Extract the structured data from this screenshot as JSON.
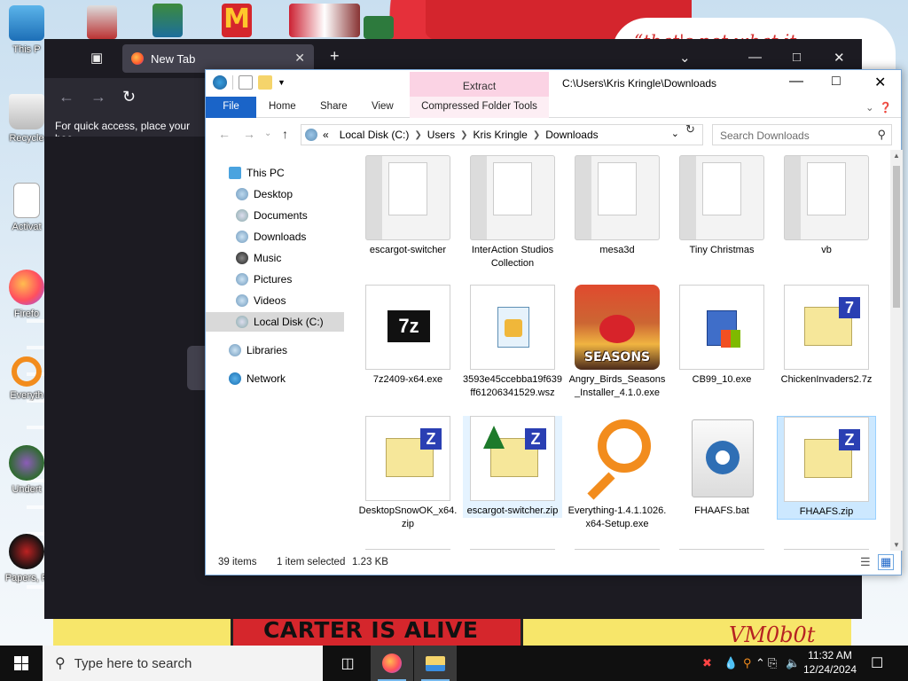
{
  "desktop": {
    "wallpaper_text": "CARTER IS ALIVE",
    "wallpaper_signature": "VM0b0t",
    "card_text": "“that's not what it",
    "icons": [
      {
        "label": "This P",
        "icon": "computer-icon"
      },
      {
        "label": "Recycle",
        "icon": "recycle-bin-icon"
      },
      {
        "label": "Activat",
        "icon": "document-icon"
      },
      {
        "label": "Firefo",
        "icon": "firefox-icon"
      },
      {
        "label": "Everyth",
        "icon": "everything-search-icon"
      },
      {
        "label": "Undert",
        "icon": "undertale-icon"
      },
      {
        "label": "Papers, P",
        "icon": "papers-please-icon"
      }
    ]
  },
  "browser": {
    "tab_title": "New Tab",
    "quick_access_text": "For quick access, place your boo"
  },
  "explorer": {
    "ribbon_context_tab": "Extract",
    "window_path": "C:\\Users\\Kris Kringle\\Downloads",
    "ribbon_tabs": {
      "file": "File",
      "home": "Home",
      "share": "Share",
      "view": "View",
      "context": "Compressed Folder Tools"
    },
    "breadcrumb": [
      "Local Disk (C:)",
      "Users",
      "Kris Kringle",
      "Downloads"
    ],
    "breadcrumb_prefix": "«",
    "search_placeholder": "Search Downloads",
    "nav": {
      "this_pc": "This PC",
      "desktop": "Desktop",
      "documents": "Documents",
      "downloads": "Downloads",
      "music": "Music",
      "pictures": "Pictures",
      "videos": "Videos",
      "local_disk": "Local Disk (C:)",
      "libraries": "Libraries",
      "network": "Network"
    },
    "items": [
      {
        "name": "escargot-switcher",
        "kind": "folder"
      },
      {
        "name": "InterAction Studios Collection",
        "kind": "folder"
      },
      {
        "name": "mesa3d",
        "kind": "folder"
      },
      {
        "name": "Tiny Christmas",
        "kind": "folder"
      },
      {
        "name": "vb",
        "kind": "folder"
      },
      {
        "name": "7z2409-x64.exe",
        "kind": "7zip-exe"
      },
      {
        "name": "3593e45ccebba19f639ff61206341529.wsz",
        "kind": "wsz"
      },
      {
        "name": "Angry_Birds_Seasons_Installer_4.1.0.exe",
        "kind": "angry-birds",
        "badge": "SEASONS"
      },
      {
        "name": "CB99_10.exe",
        "kind": "installer"
      },
      {
        "name": "ChickenInvaders2.7z",
        "kind": "7z"
      },
      {
        "name": "DesktopSnowOK_x64.zip",
        "kind": "zip"
      },
      {
        "name": "escargot-switcher.zip",
        "kind": "zip"
      },
      {
        "name": "Everything-1.4.1.1026.x64-Setup.exe",
        "kind": "everything"
      },
      {
        "name": "FHAAFS.bat",
        "kind": "bat"
      },
      {
        "name": "FHAAFS.zip",
        "kind": "zip"
      }
    ],
    "status": {
      "count": "39 items",
      "selection": "1 item selected",
      "size": "1.23 KB"
    }
  },
  "taskbar": {
    "search_placeholder": "Type here to search",
    "time": "11:32 AM",
    "date": "12/24/2024"
  },
  "colors": {
    "accent": "#1a64c8",
    "selection": "#cce8ff",
    "taskbar": "#101010"
  }
}
